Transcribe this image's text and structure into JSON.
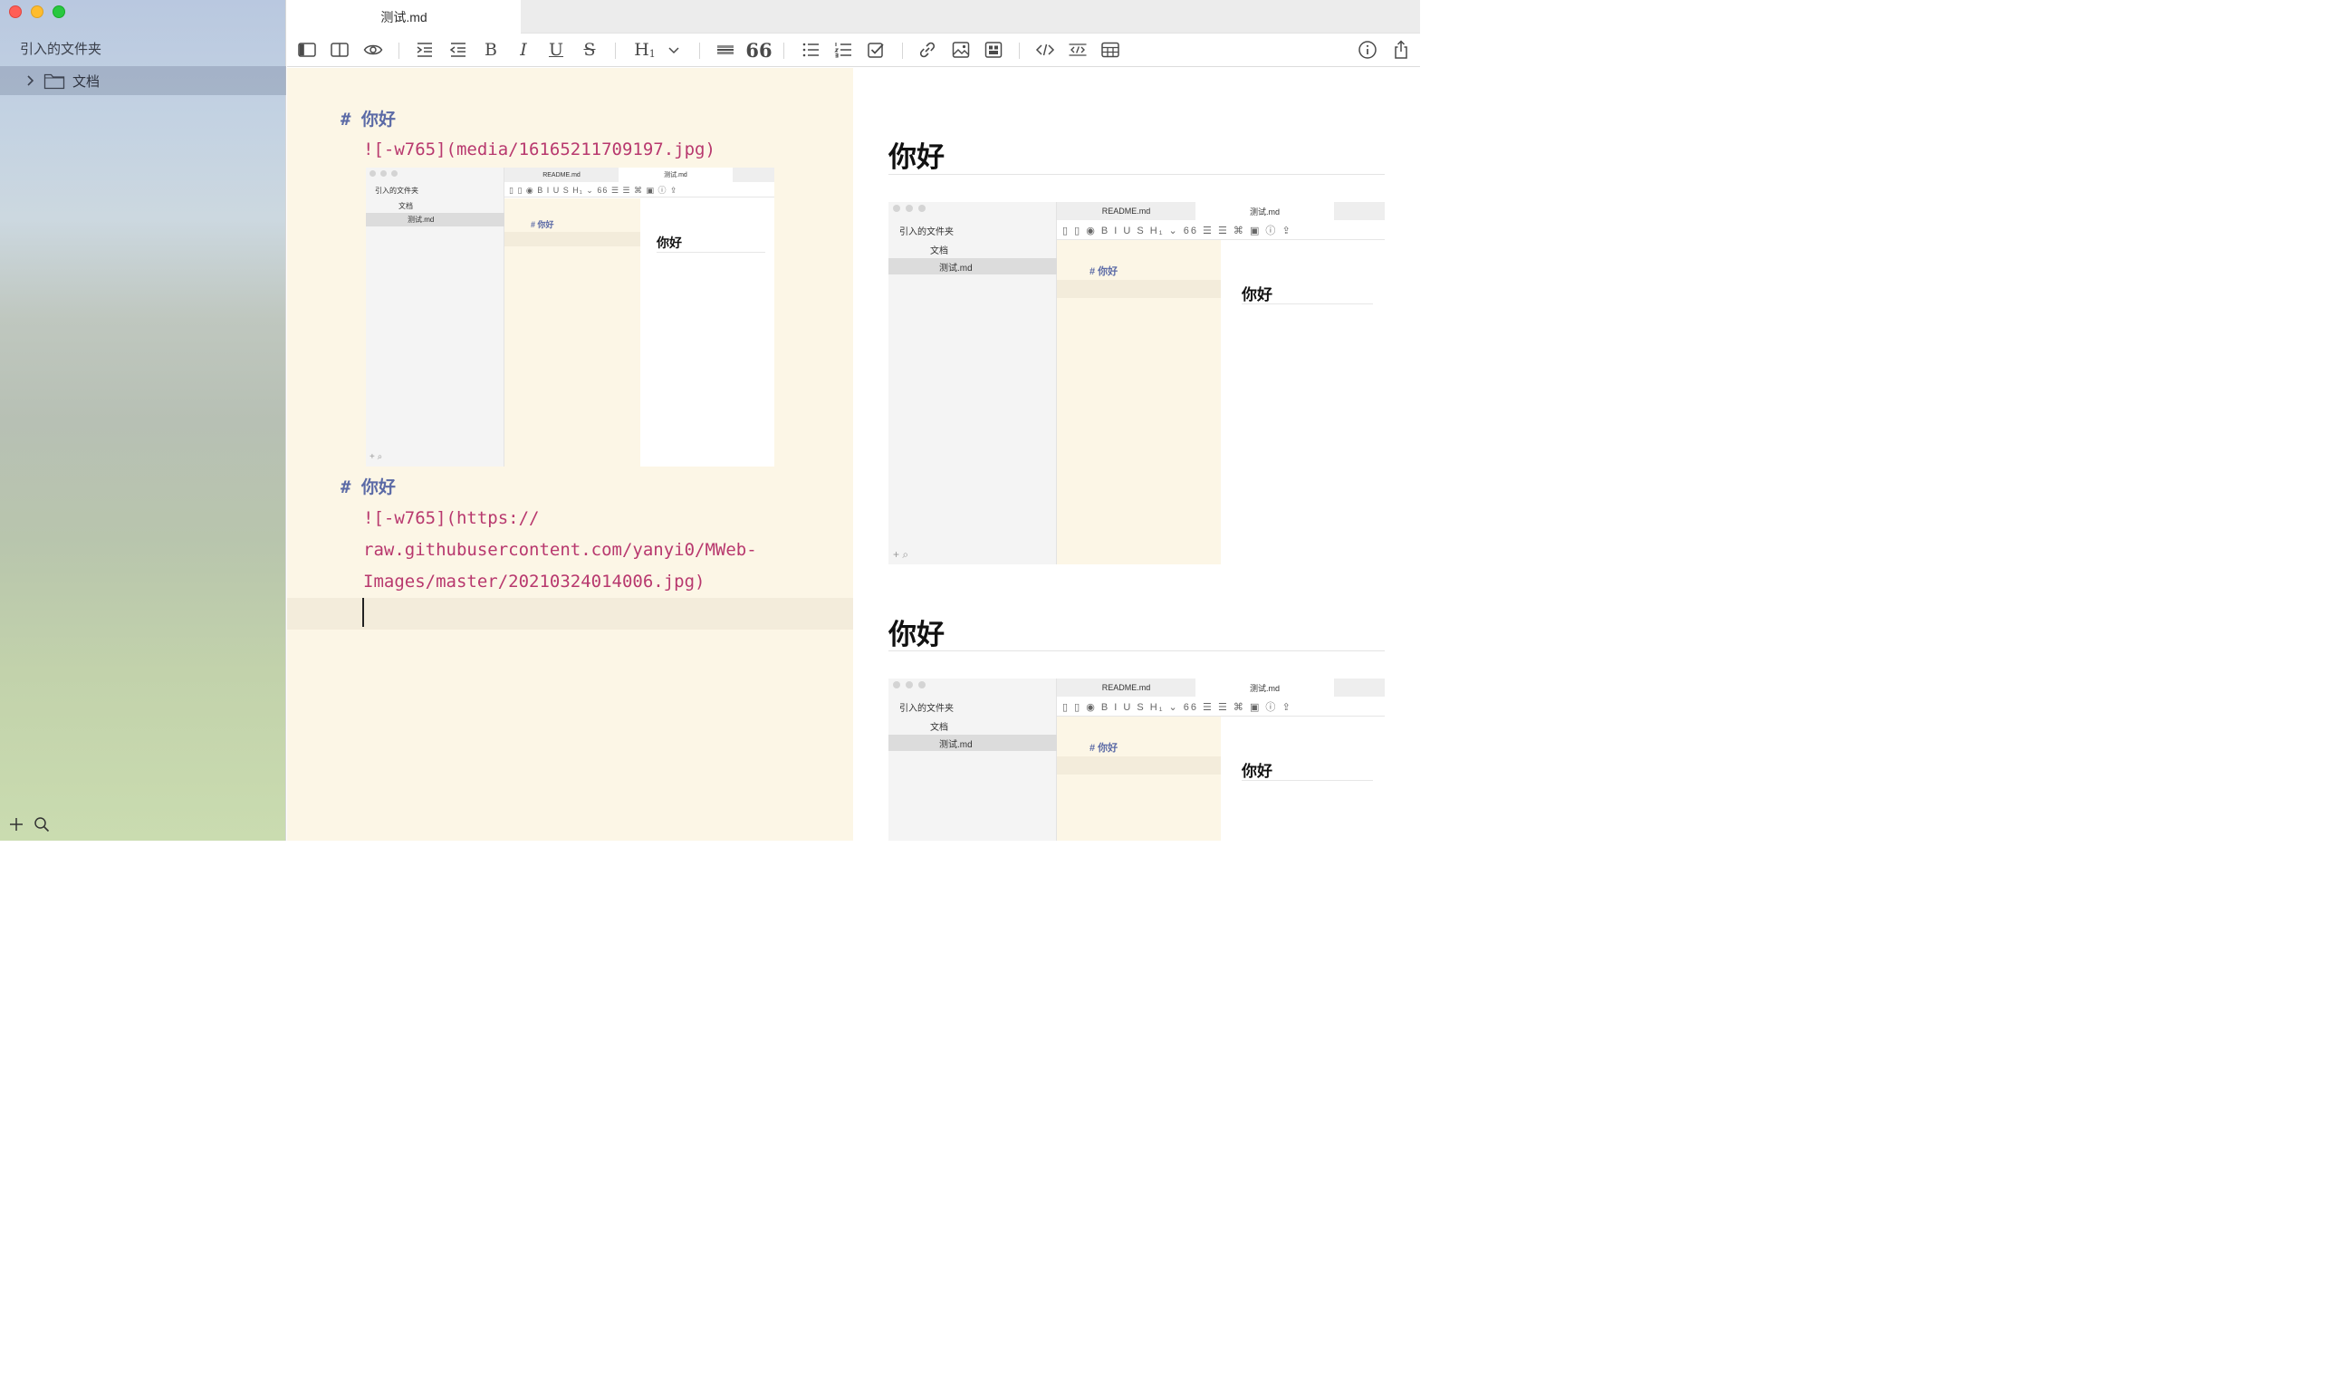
{
  "window": {
    "traffic_lights": {
      "close": "#ff5f57",
      "minimize": "#febc2e",
      "zoom": "#28c840"
    }
  },
  "sidebar": {
    "title": "引入的文件夹",
    "folder": {
      "label": "文档",
      "icon": "folder-icon",
      "expand_icon": "chevron-right-icon"
    },
    "bottom_actions": [
      "plus-icon",
      "search-icon"
    ]
  },
  "tabs": [
    {
      "label": "测试.md",
      "active": true
    }
  ],
  "toolbar": {
    "items": [
      "sidebar-toggle-icon",
      "split-view-icon",
      "preview-eye-icon",
      "indent-icon",
      "outdent-icon",
      "B",
      "I",
      "U",
      "S",
      "H1",
      "chevron-down-icon",
      "horizontal-rule-icon",
      "quote-icon",
      "bullet-list-icon",
      "numbered-list-icon",
      "checkbox-icon",
      "link-icon",
      "image-icon",
      "image-upload-icon",
      "code-icon",
      "code-block-icon",
      "table-icon",
      "info-icon",
      "share-icon"
    ],
    "bold": "B",
    "italic": "I",
    "underline": "U",
    "strike": "S",
    "heading": "H",
    "heading_sub": "1",
    "quote": "66"
  },
  "editor": {
    "blocks": [
      {
        "heading": "# 你好",
        "link": "![-w765](media/16165211709197.jpg)"
      },
      {
        "heading": "# 你好",
        "link_lines": [
          "![-w765](https://",
          "raw.githubusercontent.com/yanyi0/MWeb-",
          "Images/master/20210324014006.jpg)"
        ]
      }
    ]
  },
  "preview": {
    "headings": [
      "你好",
      "你好"
    ]
  },
  "embedded_screenshot": {
    "sidebar_title": "引入的文件夹",
    "folder": "文档",
    "file": "测试.md",
    "tabs": [
      "README.md",
      "测试.md"
    ],
    "editor_heading": "# 你好",
    "preview_heading": "你好",
    "toolbar_glyphs": "▯ ▯ ◉ B I U S H₁ ⌄ 66 ☰ ☰ ⌘ ▣   ⓘ ⇪",
    "bottom_glyphs": "+ ⌕"
  },
  "colors": {
    "accent_heading_md": "#5b6aa6",
    "link_md": "#b8386e",
    "editor_bg": "#fcf6e6",
    "current_line": "#f3ecdb"
  }
}
